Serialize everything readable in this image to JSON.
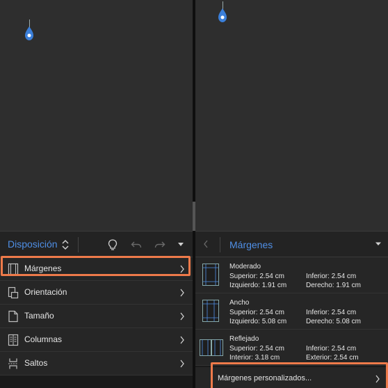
{
  "left": {
    "toolbar": {
      "title": "Disposición",
      "icons": [
        "updown-icon",
        "lightbulb-icon",
        "undo-icon",
        "redo-icon",
        "dropdown-icon"
      ]
    },
    "items": [
      {
        "label": "Márgenes",
        "icon": "margins-icon"
      },
      {
        "label": "Orientación",
        "icon": "orientation-icon"
      },
      {
        "label": "Tamaño",
        "icon": "size-icon"
      },
      {
        "label": "Columnas",
        "icon": "columns-icon"
      },
      {
        "label": "Saltos",
        "icon": "breaks-icon"
      }
    ]
  },
  "right": {
    "toolbar": {
      "title": "Márgenes"
    },
    "presets": [
      {
        "name": "Moderado",
        "a": "Superior: 2.54 cm",
        "b": "Inferior: 2.54 cm",
        "c": "Izquierdo: 1.91 cm",
        "d": "Derecho: 1.91 cm"
      },
      {
        "name": "Ancho",
        "a": "Superior: 2.54 cm",
        "b": "Inferior: 2.54 cm",
        "c": "Izquierdo: 5.08 cm",
        "d": "Derecho: 5.08 cm"
      },
      {
        "name": "Reflejado",
        "a": "Superior: 2.54 cm",
        "b": "Inferior: 2.54 cm",
        "c": "Interior: 3.18 cm",
        "d": "Exterior: 2.54 cm"
      }
    ],
    "custom_label": "Márgenes personalizados..."
  },
  "colors": {
    "accent": "#4f8fe6",
    "highlight": "#ee7a4a"
  }
}
